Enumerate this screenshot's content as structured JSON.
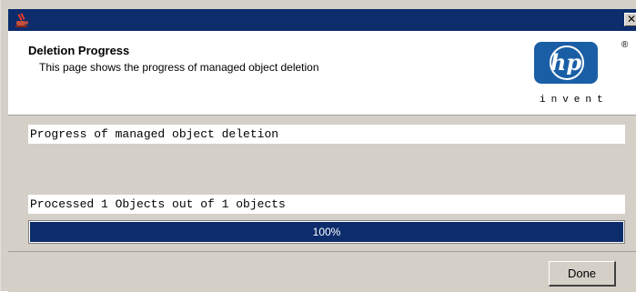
{
  "window": {
    "title": "",
    "close_glyph": "✕"
  },
  "header": {
    "title": "Deletion Progress",
    "subtitle": "This page shows the progress of managed object deletion"
  },
  "logo": {
    "brand": "hp",
    "tagline": "invent",
    "registered": "®"
  },
  "main": {
    "status_label": "Progress of managed object deletion",
    "processed_text": "Processed 1 Objects out of 1 objects",
    "progress_percent": 100,
    "progress_text": "100%"
  },
  "footer": {
    "done_label": "Done"
  },
  "colors": {
    "titlebar": "#0c2c6c",
    "progress_fill": "#0c2c6c",
    "dialog_bg": "#d4d0c8"
  },
  "icons": {
    "title_icon": "java-app-icon",
    "close": "close-icon"
  }
}
